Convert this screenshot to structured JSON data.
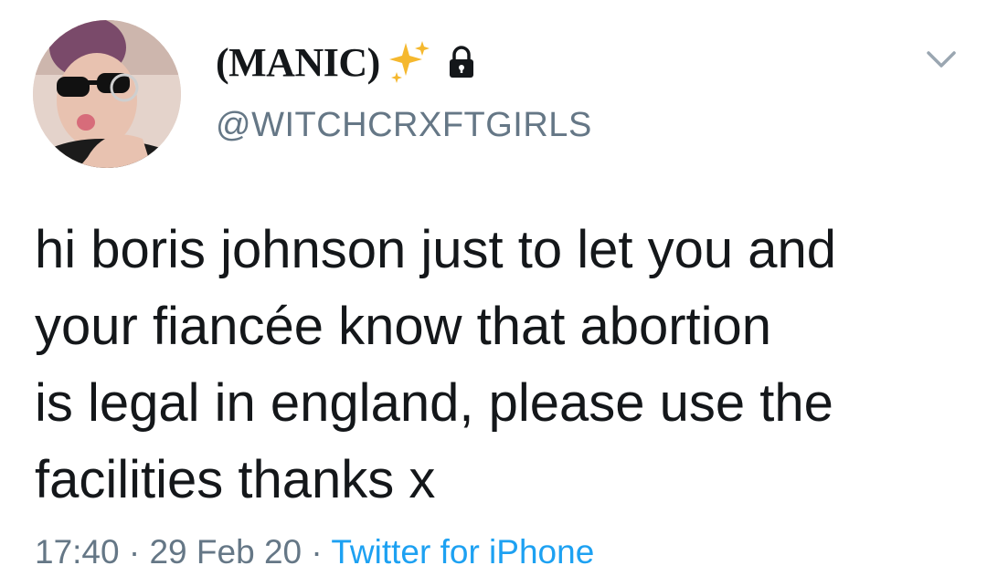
{
  "tweet": {
    "display_name": "(MANIC)",
    "handle": "@WITCHCRXFTGIRLS",
    "text": "hi boris johnson just to let you and\nyour fiancée know that abortion\nis legal in england, please use the\nfacilities thanks x",
    "time": "17:40",
    "separator": "·",
    "date": "29 Feb 20",
    "source": "Twitter for iPhone"
  },
  "icons": {
    "name_emoji": "sparkles-icon",
    "protected": "lock-icon",
    "menu": "chevron-down-icon"
  },
  "colors": {
    "text": "#14171a",
    "secondary": "#657786",
    "link": "#1da1f2",
    "sparkle": "#f5b82e"
  }
}
